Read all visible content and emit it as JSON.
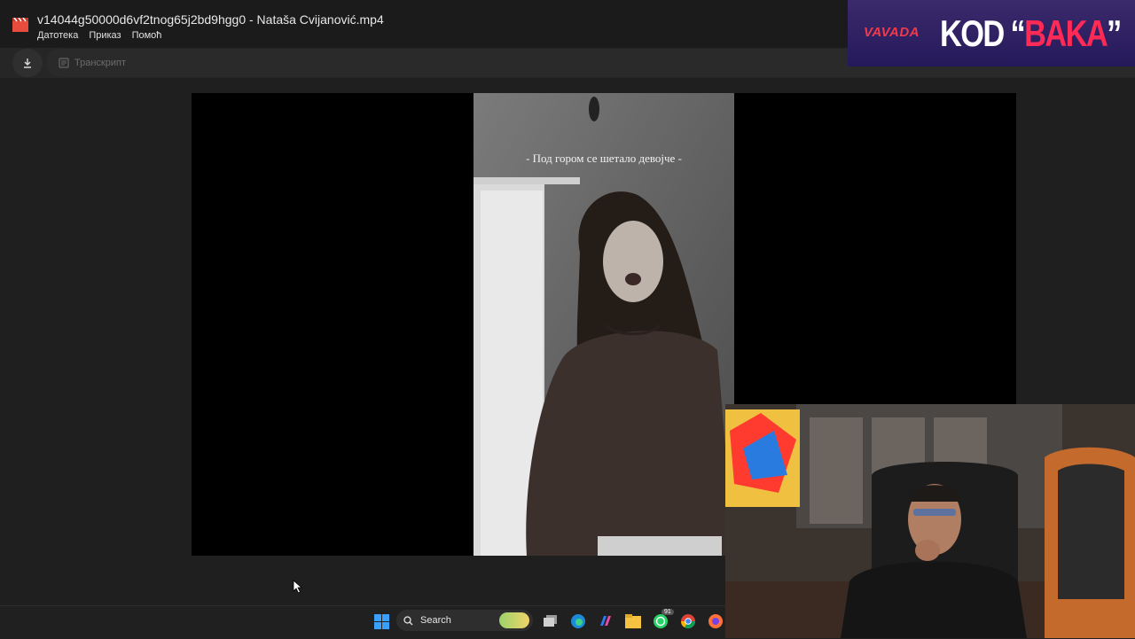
{
  "window": {
    "title": "v14044g50000d6vf2tnog65j2bd9hgg0 - Nataša Cvijanović.mp4",
    "menu": [
      "Датотека",
      "Приказ",
      "Помоћ"
    ]
  },
  "toolbar": {
    "download_icon": "download-icon",
    "transcript_label": "Транскрипт",
    "transcript_icon": "transcript-icon"
  },
  "video": {
    "caption": "- Под гором се шетало девојче -"
  },
  "taskbar": {
    "search_label": "Search",
    "whatsapp_badge": "91",
    "icons": [
      "windows-start-icon",
      "search-icon",
      "task-view-icon",
      "edge-icon",
      "copilot-icon",
      "file-explorer-icon",
      "whatsapp-icon",
      "chrome-icon",
      "firefox-icon"
    ]
  },
  "overlay": {
    "brand": "VAVADA",
    "promo_prefix": "KOD “",
    "promo_highlight": "BAKA",
    "promo_suffix": "”"
  },
  "colors": {
    "accent": "#ff2a55",
    "banner_bg": "#2c1f63",
    "app_bg": "#1f1f1f"
  }
}
